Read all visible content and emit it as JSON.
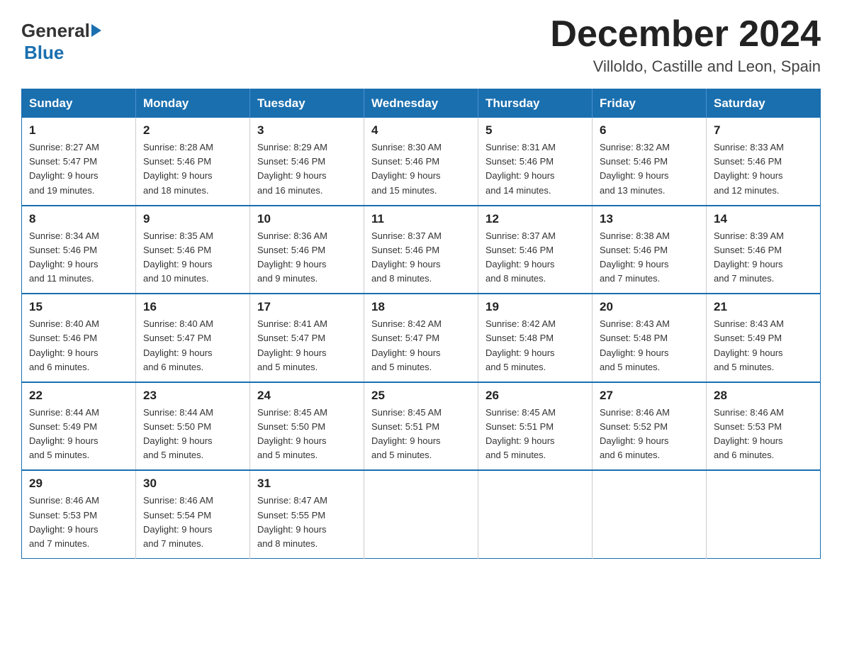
{
  "header": {
    "logo_general": "General",
    "logo_blue": "Blue",
    "month_year": "December 2024",
    "location": "Villoldo, Castille and Leon, Spain"
  },
  "days_of_week": [
    "Sunday",
    "Monday",
    "Tuesday",
    "Wednesday",
    "Thursday",
    "Friday",
    "Saturday"
  ],
  "weeks": [
    [
      {
        "day": "1",
        "sunrise": "8:27 AM",
        "sunset": "5:47 PM",
        "daylight": "9 hours and 19 minutes."
      },
      {
        "day": "2",
        "sunrise": "8:28 AM",
        "sunset": "5:46 PM",
        "daylight": "9 hours and 18 minutes."
      },
      {
        "day": "3",
        "sunrise": "8:29 AM",
        "sunset": "5:46 PM",
        "daylight": "9 hours and 16 minutes."
      },
      {
        "day": "4",
        "sunrise": "8:30 AM",
        "sunset": "5:46 PM",
        "daylight": "9 hours and 15 minutes."
      },
      {
        "day": "5",
        "sunrise": "8:31 AM",
        "sunset": "5:46 PM",
        "daylight": "9 hours and 14 minutes."
      },
      {
        "day": "6",
        "sunrise": "8:32 AM",
        "sunset": "5:46 PM",
        "daylight": "9 hours and 13 minutes."
      },
      {
        "day": "7",
        "sunrise": "8:33 AM",
        "sunset": "5:46 PM",
        "daylight": "9 hours and 12 minutes."
      }
    ],
    [
      {
        "day": "8",
        "sunrise": "8:34 AM",
        "sunset": "5:46 PM",
        "daylight": "9 hours and 11 minutes."
      },
      {
        "day": "9",
        "sunrise": "8:35 AM",
        "sunset": "5:46 PM",
        "daylight": "9 hours and 10 minutes."
      },
      {
        "day": "10",
        "sunrise": "8:36 AM",
        "sunset": "5:46 PM",
        "daylight": "9 hours and 9 minutes."
      },
      {
        "day": "11",
        "sunrise": "8:37 AM",
        "sunset": "5:46 PM",
        "daylight": "9 hours and 8 minutes."
      },
      {
        "day": "12",
        "sunrise": "8:37 AM",
        "sunset": "5:46 PM",
        "daylight": "9 hours and 8 minutes."
      },
      {
        "day": "13",
        "sunrise": "8:38 AM",
        "sunset": "5:46 PM",
        "daylight": "9 hours and 7 minutes."
      },
      {
        "day": "14",
        "sunrise": "8:39 AM",
        "sunset": "5:46 PM",
        "daylight": "9 hours and 7 minutes."
      }
    ],
    [
      {
        "day": "15",
        "sunrise": "8:40 AM",
        "sunset": "5:46 PM",
        "daylight": "9 hours and 6 minutes."
      },
      {
        "day": "16",
        "sunrise": "8:40 AM",
        "sunset": "5:47 PM",
        "daylight": "9 hours and 6 minutes."
      },
      {
        "day": "17",
        "sunrise": "8:41 AM",
        "sunset": "5:47 PM",
        "daylight": "9 hours and 5 minutes."
      },
      {
        "day": "18",
        "sunrise": "8:42 AM",
        "sunset": "5:47 PM",
        "daylight": "9 hours and 5 minutes."
      },
      {
        "day": "19",
        "sunrise": "8:42 AM",
        "sunset": "5:48 PM",
        "daylight": "9 hours and 5 minutes."
      },
      {
        "day": "20",
        "sunrise": "8:43 AM",
        "sunset": "5:48 PM",
        "daylight": "9 hours and 5 minutes."
      },
      {
        "day": "21",
        "sunrise": "8:43 AM",
        "sunset": "5:49 PM",
        "daylight": "9 hours and 5 minutes."
      }
    ],
    [
      {
        "day": "22",
        "sunrise": "8:44 AM",
        "sunset": "5:49 PM",
        "daylight": "9 hours and 5 minutes."
      },
      {
        "day": "23",
        "sunrise": "8:44 AM",
        "sunset": "5:50 PM",
        "daylight": "9 hours and 5 minutes."
      },
      {
        "day": "24",
        "sunrise": "8:45 AM",
        "sunset": "5:50 PM",
        "daylight": "9 hours and 5 minutes."
      },
      {
        "day": "25",
        "sunrise": "8:45 AM",
        "sunset": "5:51 PM",
        "daylight": "9 hours and 5 minutes."
      },
      {
        "day": "26",
        "sunrise": "8:45 AM",
        "sunset": "5:51 PM",
        "daylight": "9 hours and 5 minutes."
      },
      {
        "day": "27",
        "sunrise": "8:46 AM",
        "sunset": "5:52 PM",
        "daylight": "9 hours and 6 minutes."
      },
      {
        "day": "28",
        "sunrise": "8:46 AM",
        "sunset": "5:53 PM",
        "daylight": "9 hours and 6 minutes."
      }
    ],
    [
      {
        "day": "29",
        "sunrise": "8:46 AM",
        "sunset": "5:53 PM",
        "daylight": "9 hours and 7 minutes."
      },
      {
        "day": "30",
        "sunrise": "8:46 AM",
        "sunset": "5:54 PM",
        "daylight": "9 hours and 7 minutes."
      },
      {
        "day": "31",
        "sunrise": "8:47 AM",
        "sunset": "5:55 PM",
        "daylight": "9 hours and 8 minutes."
      },
      null,
      null,
      null,
      null
    ]
  ],
  "labels": {
    "sunrise": "Sunrise:",
    "sunset": "Sunset:",
    "daylight": "Daylight:"
  }
}
